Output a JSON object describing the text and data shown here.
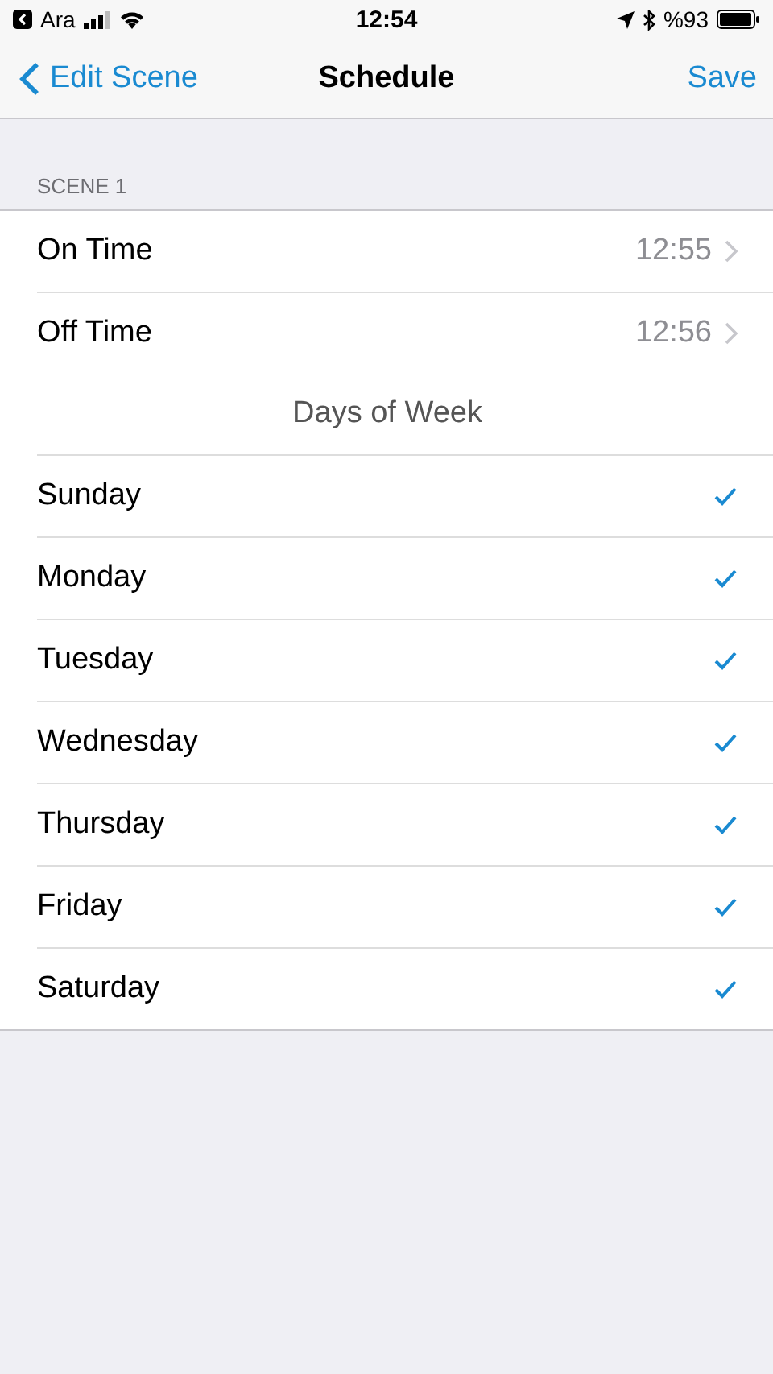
{
  "status_bar": {
    "back_app": "Ara",
    "time": "12:54",
    "battery": "%93"
  },
  "nav": {
    "back": "Edit Scene",
    "title": "Schedule",
    "action": "Save"
  },
  "section": {
    "header": "SCENE 1"
  },
  "rows": [
    {
      "kind": "time",
      "label": "On Time",
      "value": "12:55"
    },
    {
      "kind": "time",
      "label": "Off Time",
      "value": "12:56"
    },
    {
      "kind": "header",
      "label": "Days of Week"
    },
    {
      "kind": "day",
      "label": "Sunday",
      "checked": true
    },
    {
      "kind": "day",
      "label": "Monday",
      "checked": true
    },
    {
      "kind": "day",
      "label": "Tuesday",
      "checked": true
    },
    {
      "kind": "day",
      "label": "Wednesday",
      "checked": true
    },
    {
      "kind": "day",
      "label": "Thursday",
      "checked": true
    },
    {
      "kind": "day",
      "label": "Friday",
      "checked": true
    },
    {
      "kind": "day",
      "label": "Saturday",
      "checked": true
    }
  ]
}
